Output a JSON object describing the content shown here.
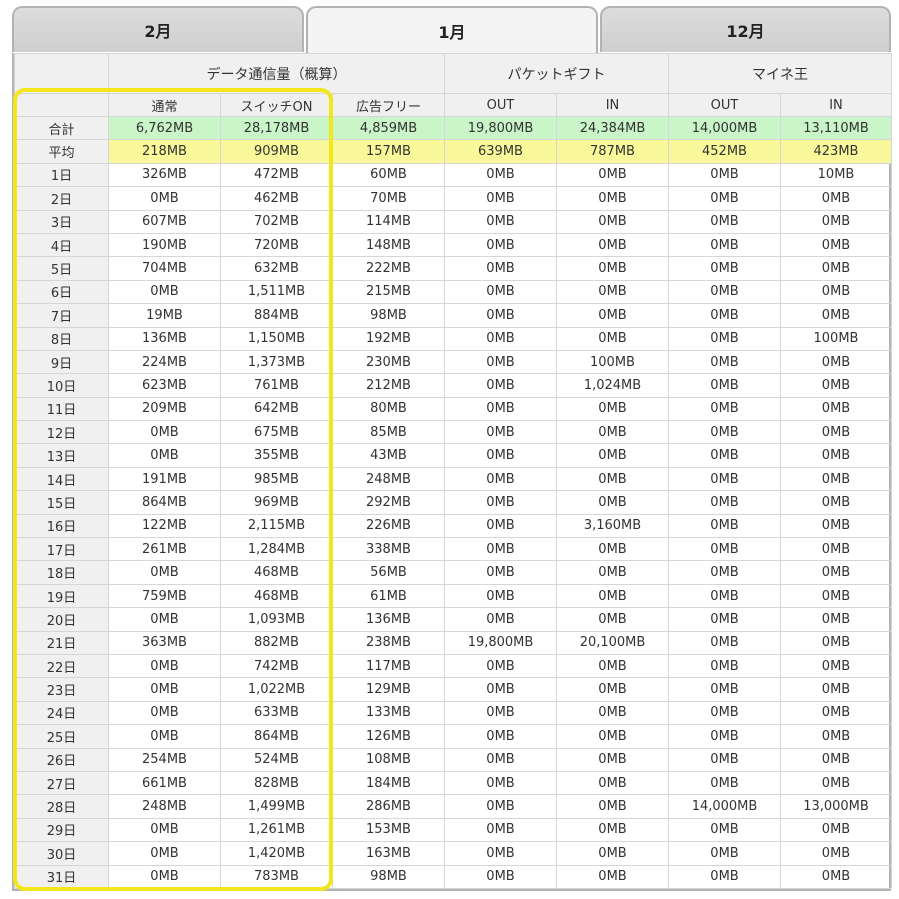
{
  "tabs": [
    {
      "label": "2月",
      "active": false
    },
    {
      "label": "1月",
      "active": true
    },
    {
      "label": "12月",
      "active": false
    }
  ],
  "header": {
    "group_data": "データ通信量（概算）",
    "group_packet": "パケットギフト",
    "group_maine": "マイネ王",
    "col_normal": "通常",
    "col_switch": "スイッチON",
    "col_adfree": "広告フリー",
    "col_pk_out": "OUT",
    "col_pk_in": "IN",
    "col_mn_out": "OUT",
    "col_mn_in": "IN"
  },
  "summary": {
    "total": {
      "label": "合計",
      "values": [
        "6,762MB",
        "28,178MB",
        "4,859MB",
        "19,800MB",
        "24,384MB",
        "14,000MB",
        "13,110MB"
      ]
    },
    "average": {
      "label": "平均",
      "values": [
        "218MB",
        "909MB",
        "157MB",
        "639MB",
        "787MB",
        "452MB",
        "423MB"
      ]
    }
  },
  "colors": {
    "total_row": "#c9f5c9",
    "average_row": "#f8f89a",
    "highlight_border": "#f3e61a"
  },
  "rows": [
    {
      "day": "1日",
      "values": [
        "326MB",
        "472MB",
        "60MB",
        "0MB",
        "0MB",
        "0MB",
        "10MB"
      ]
    },
    {
      "day": "2日",
      "values": [
        "0MB",
        "462MB",
        "70MB",
        "0MB",
        "0MB",
        "0MB",
        "0MB"
      ]
    },
    {
      "day": "3日",
      "values": [
        "607MB",
        "702MB",
        "114MB",
        "0MB",
        "0MB",
        "0MB",
        "0MB"
      ]
    },
    {
      "day": "4日",
      "values": [
        "190MB",
        "720MB",
        "148MB",
        "0MB",
        "0MB",
        "0MB",
        "0MB"
      ]
    },
    {
      "day": "5日",
      "values": [
        "704MB",
        "632MB",
        "222MB",
        "0MB",
        "0MB",
        "0MB",
        "0MB"
      ]
    },
    {
      "day": "6日",
      "values": [
        "0MB",
        "1,511MB",
        "215MB",
        "0MB",
        "0MB",
        "0MB",
        "0MB"
      ]
    },
    {
      "day": "7日",
      "values": [
        "19MB",
        "884MB",
        "98MB",
        "0MB",
        "0MB",
        "0MB",
        "0MB"
      ]
    },
    {
      "day": "8日",
      "values": [
        "136MB",
        "1,150MB",
        "192MB",
        "0MB",
        "0MB",
        "0MB",
        "100MB"
      ]
    },
    {
      "day": "9日",
      "values": [
        "224MB",
        "1,373MB",
        "230MB",
        "0MB",
        "100MB",
        "0MB",
        "0MB"
      ]
    },
    {
      "day": "10日",
      "values": [
        "623MB",
        "761MB",
        "212MB",
        "0MB",
        "1,024MB",
        "0MB",
        "0MB"
      ]
    },
    {
      "day": "11日",
      "values": [
        "209MB",
        "642MB",
        "80MB",
        "0MB",
        "0MB",
        "0MB",
        "0MB"
      ]
    },
    {
      "day": "12日",
      "values": [
        "0MB",
        "675MB",
        "85MB",
        "0MB",
        "0MB",
        "0MB",
        "0MB"
      ]
    },
    {
      "day": "13日",
      "values": [
        "0MB",
        "355MB",
        "43MB",
        "0MB",
        "0MB",
        "0MB",
        "0MB"
      ]
    },
    {
      "day": "14日",
      "values": [
        "191MB",
        "985MB",
        "248MB",
        "0MB",
        "0MB",
        "0MB",
        "0MB"
      ]
    },
    {
      "day": "15日",
      "values": [
        "864MB",
        "969MB",
        "292MB",
        "0MB",
        "0MB",
        "0MB",
        "0MB"
      ]
    },
    {
      "day": "16日",
      "values": [
        "122MB",
        "2,115MB",
        "226MB",
        "0MB",
        "3,160MB",
        "0MB",
        "0MB"
      ]
    },
    {
      "day": "17日",
      "values": [
        "261MB",
        "1,284MB",
        "338MB",
        "0MB",
        "0MB",
        "0MB",
        "0MB"
      ]
    },
    {
      "day": "18日",
      "values": [
        "0MB",
        "468MB",
        "56MB",
        "0MB",
        "0MB",
        "0MB",
        "0MB"
      ]
    },
    {
      "day": "19日",
      "values": [
        "759MB",
        "468MB",
        "61MB",
        "0MB",
        "0MB",
        "0MB",
        "0MB"
      ]
    },
    {
      "day": "20日",
      "values": [
        "0MB",
        "1,093MB",
        "136MB",
        "0MB",
        "0MB",
        "0MB",
        "0MB"
      ]
    },
    {
      "day": "21日",
      "values": [
        "363MB",
        "882MB",
        "238MB",
        "19,800MB",
        "20,100MB",
        "0MB",
        "0MB"
      ]
    },
    {
      "day": "22日",
      "values": [
        "0MB",
        "742MB",
        "117MB",
        "0MB",
        "0MB",
        "0MB",
        "0MB"
      ]
    },
    {
      "day": "23日",
      "values": [
        "0MB",
        "1,022MB",
        "129MB",
        "0MB",
        "0MB",
        "0MB",
        "0MB"
      ]
    },
    {
      "day": "24日",
      "values": [
        "0MB",
        "633MB",
        "133MB",
        "0MB",
        "0MB",
        "0MB",
        "0MB"
      ]
    },
    {
      "day": "25日",
      "values": [
        "0MB",
        "864MB",
        "126MB",
        "0MB",
        "0MB",
        "0MB",
        "0MB"
      ]
    },
    {
      "day": "26日",
      "values": [
        "254MB",
        "524MB",
        "108MB",
        "0MB",
        "0MB",
        "0MB",
        "0MB"
      ]
    },
    {
      "day": "27日",
      "values": [
        "661MB",
        "828MB",
        "184MB",
        "0MB",
        "0MB",
        "0MB",
        "0MB"
      ]
    },
    {
      "day": "28日",
      "values": [
        "248MB",
        "1,499MB",
        "286MB",
        "0MB",
        "0MB",
        "14,000MB",
        "13,000MB"
      ]
    },
    {
      "day": "29日",
      "values": [
        "0MB",
        "1,261MB",
        "153MB",
        "0MB",
        "0MB",
        "0MB",
        "0MB"
      ]
    },
    {
      "day": "30日",
      "values": [
        "0MB",
        "1,420MB",
        "163MB",
        "0MB",
        "0MB",
        "0MB",
        "0MB"
      ]
    },
    {
      "day": "31日",
      "values": [
        "0MB",
        "783MB",
        "98MB",
        "0MB",
        "0MB",
        "0MB",
        "0MB"
      ]
    }
  ]
}
